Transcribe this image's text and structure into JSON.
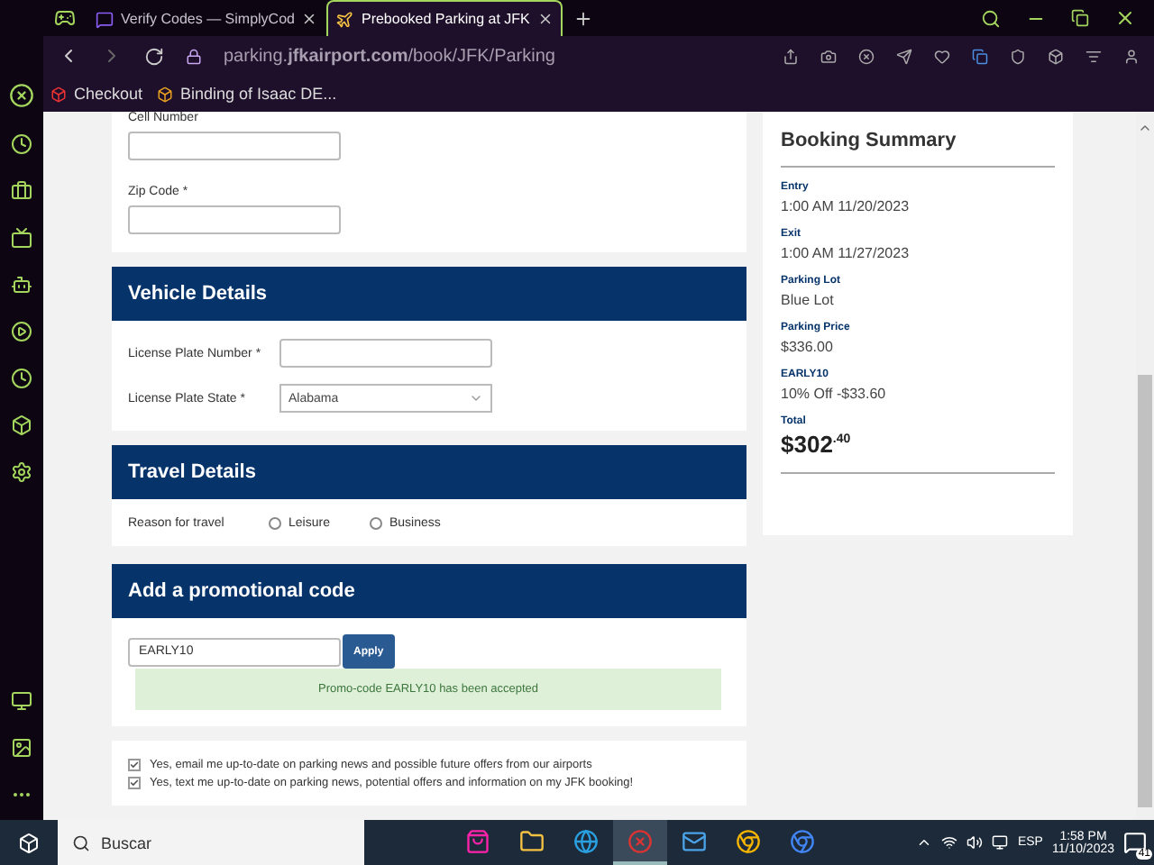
{
  "browser": {
    "tabs": [
      {
        "title": "Verify Codes — SimplyCod",
        "selected": false
      },
      {
        "title": "Prebooked Parking at JFK",
        "selected": true
      }
    ],
    "url": "parking.**jfkairport.com**/book/JFK/Parking",
    "bookmarks": [
      {
        "label": "Checkout"
      },
      {
        "label": "Binding of Isaac DE..."
      }
    ]
  },
  "contact_form": {
    "fields": [
      {
        "label": "Cell Number"
      },
      {
        "label": "Zip Code *"
      }
    ]
  },
  "vehicle_details": {
    "title": "Vehicle Details",
    "plate_number": {
      "label": "License Plate Number *"
    },
    "plate_state": {
      "label": "License Plate State *",
      "value": "Alabama"
    }
  },
  "travel_details": {
    "title": "Travel Details",
    "label": "Reason for travel",
    "options": [
      {
        "label": "Leisure",
        "selected": false
      },
      {
        "label": "Business",
        "selected": false
      }
    ]
  },
  "promo": {
    "title": "Add a promotional code",
    "value": "EARLY10",
    "button": "Apply",
    "message": "Promo-code EARLY10 has been accepted"
  },
  "consents": [
    {
      "label": "Yes, email me up-to-date on parking news and possible future offers from our airports",
      "checked": true
    },
    {
      "label": "Yes, text me up-to-date on parking news, potential offers and information on my JFK booking!",
      "checked": true
    }
  ],
  "summary": {
    "title": "Booking Summary",
    "items": [
      {
        "label": "Entry",
        "value": "1:00 AM 11/20/2023"
      },
      {
        "label": "Exit",
        "value": "1:00 AM 11/27/2023"
      },
      {
        "label": "Parking Lot",
        "value": "Blue Lot"
      },
      {
        "label": "Parking Price",
        "value": "$336.00"
      },
      {
        "label": "EARLY10",
        "value": "10% Off -$33.60"
      }
    ],
    "total_label": "Total",
    "total": "$302",
    "total_cents": ".40"
  },
  "taskbar": {
    "search": "Buscar",
    "apps": [
      {
        "selected": false
      },
      {
        "selected": false
      },
      {
        "selected": false
      },
      {
        "selected": true
      },
      {
        "selected": false
      },
      {
        "selected": false
      },
      {
        "selected": false
      }
    ],
    "language": "ESP",
    "time": "1:58 PM",
    "date": "11/10/2023",
    "notifications": "41"
  }
}
